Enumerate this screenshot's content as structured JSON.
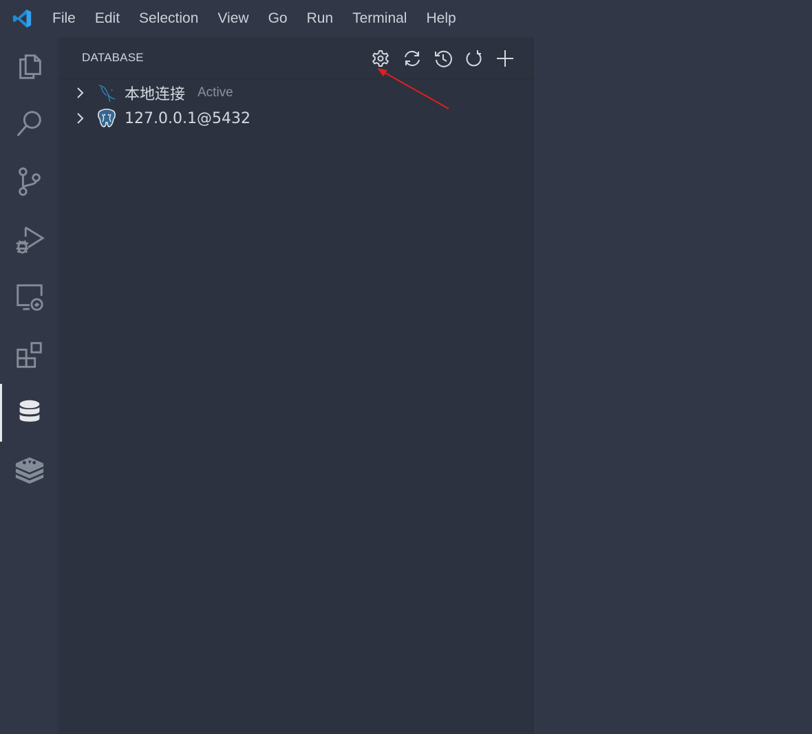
{
  "menubar": {
    "items": [
      "File",
      "Edit",
      "Selection",
      "View",
      "Go",
      "Run",
      "Terminal",
      "Help"
    ]
  },
  "activitybar": {
    "items": [
      {
        "name": "explorer",
        "icon": "files-icon"
      },
      {
        "name": "search",
        "icon": "search-icon"
      },
      {
        "name": "source-control",
        "icon": "source-control-icon"
      },
      {
        "name": "run-debug",
        "icon": "run-debug-icon"
      },
      {
        "name": "remote-explorer",
        "icon": "remote-explorer-icon"
      },
      {
        "name": "extensions",
        "icon": "extensions-icon"
      },
      {
        "name": "database",
        "icon": "database-icon",
        "active": true
      },
      {
        "name": "redis",
        "icon": "redis-icon"
      }
    ]
  },
  "sidebar": {
    "title": "DATABASE",
    "actions": [
      "gear-icon",
      "sync-icon",
      "history-icon",
      "refresh-icon",
      "add-icon"
    ],
    "tree": [
      {
        "label": "本地连接",
        "description": "Active",
        "icon": "mysql-icon"
      },
      {
        "label": "127.0.0.1@5432",
        "description": "",
        "icon": "postgresql-icon"
      }
    ]
  },
  "colors": {
    "background": "#313746",
    "sidebar": "#2c3240",
    "accent": "#0e7acc",
    "annotation_arrow": "#e0201c"
  }
}
